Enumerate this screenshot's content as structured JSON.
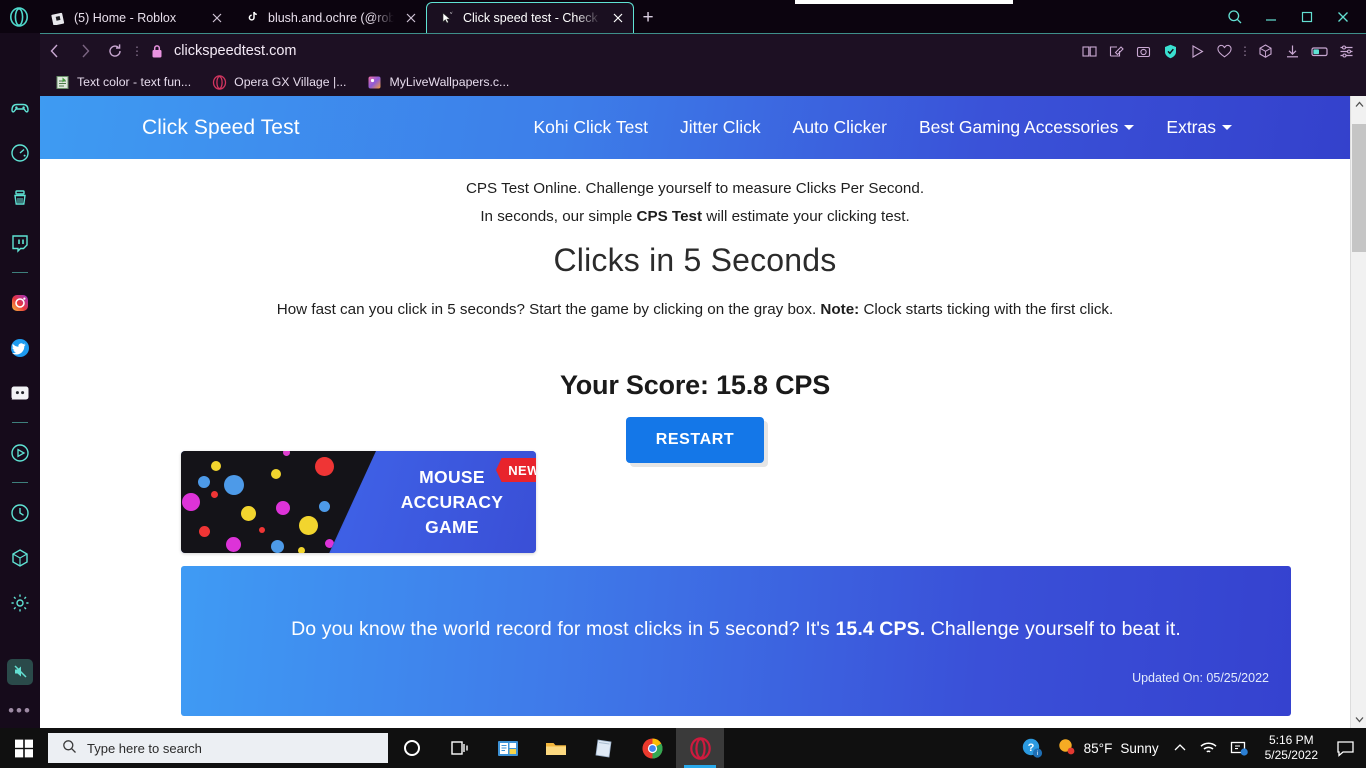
{
  "browser": {
    "name": "Opera GX",
    "tabs": [
      {
        "title": "(5) Home - Roblox",
        "favicon": "roblox-icon",
        "active": false
      },
      {
        "title": "blush.and.ochre (@roblox_b",
        "favicon": "tiktok-icon",
        "active": false
      },
      {
        "title": "Click speed test - Check Cli",
        "favicon": "cursor-icon",
        "active": true
      }
    ],
    "new_tab_label": "+",
    "window_controls": {
      "search": "search-icon",
      "minimize": "minimize-icon",
      "maximize": "maximize-icon",
      "close": "close-icon"
    },
    "toolbar": {
      "back": "back-arrow-icon",
      "forward": "forward-arrow-icon",
      "reload": "reload-icon",
      "lock": "lock-icon",
      "url": "clickspeedtest.com",
      "right_icons": [
        "reader-icon",
        "snapshot-edit-icon",
        "camera-icon",
        "vpn-shield-icon",
        "player-icon",
        "heart-icon",
        "extensions-cube-icon",
        "downloads-icon",
        "tab-island-icon",
        "easy-setup-icon"
      ]
    },
    "bookmarks": [
      {
        "label": "Text color - text fun...",
        "icon": "document-icon"
      },
      {
        "label": "Opera GX Village |...",
        "icon": "opera-gx-icon"
      },
      {
        "label": "MyLiveWallpapers.c...",
        "icon": "wallpaper-icon"
      }
    ],
    "sidebar_items": [
      {
        "name": "gx-corner-gamepad-icon"
      },
      {
        "name": "gx-control-speedometer-icon"
      },
      {
        "name": "gx-cleaner-icon"
      },
      {
        "name": "twitch-icon"
      },
      {
        "name": "instagram-icon"
      },
      {
        "name": "twitter-icon"
      },
      {
        "name": "discord-icon"
      },
      {
        "name": "player-icon"
      },
      {
        "name": "history-clock-icon"
      },
      {
        "name": "extensions-cube-icon"
      },
      {
        "name": "settings-gear-icon"
      },
      {
        "name": "mute-tab-icon"
      },
      {
        "name": "more-dots-icon"
      }
    ],
    "scrollbar": {
      "up": "chevron-up-icon",
      "down": "chevron-down-icon"
    }
  },
  "site": {
    "brand": "Click Speed Test",
    "nav": [
      {
        "label": "Kohi Click Test",
        "dropdown": false
      },
      {
        "label": "Jitter Click",
        "dropdown": false
      },
      {
        "label": "Auto Clicker",
        "dropdown": false
      },
      {
        "label": "Best Gaming Accessories",
        "dropdown": true
      },
      {
        "label": "Extras",
        "dropdown": true
      }
    ],
    "intro_line1": "CPS Test Online. Challenge yourself to measure Clicks Per Second.",
    "intro_line2_a": "In seconds, our simple ",
    "intro_line2_b": "CPS Test",
    "intro_line2_c": " will estimate your clicking test.",
    "heading": "Clicks in 5 Seconds",
    "subtext_a": "How fast can you click in 5 seconds? Start the game by clicking on the gray box. ",
    "subtext_b": "Note:",
    "subtext_c": " Clock starts ticking with the first click.",
    "score_label": "Your Score: 15.8 CPS",
    "restart_label": "RESTART",
    "accuracy_banner": {
      "line1": "MOUSE",
      "line2": "ACCURACY",
      "line3": "GAME",
      "badge": "NEW"
    },
    "world_record": {
      "text_a": "Do you know the world record for most clicks in 5 second? It's ",
      "text_b": "15.4 CPS.",
      "text_c": " Challenge yourself to beat it.",
      "updated": "Updated On: 05/25/2022"
    },
    "colors": {
      "header_start": "#3e9bf2",
      "header_end": "#3441cc",
      "button_blue": "#1477e8",
      "badge_red": "#e8232c"
    }
  },
  "taskbar": {
    "start": "windows-start-icon",
    "search_placeholder": "Type here to search",
    "items": [
      {
        "name": "cortana-icon"
      },
      {
        "name": "task-view-icon"
      },
      {
        "name": "mail-store-icon"
      },
      {
        "name": "file-explorer-icon"
      },
      {
        "name": "sticky-notes-icon"
      },
      {
        "name": "google-chrome-icon"
      },
      {
        "name": "opera-gx-icon",
        "active": true
      }
    ],
    "tray": {
      "help": "help-icon",
      "weather_temp": "85°F",
      "weather_desc": "Sunny",
      "overflow": "chevron-up-icon",
      "wifi": "wifi-icon",
      "network": "network-icon",
      "time": "5:16 PM",
      "date": "5/25/2022",
      "action_center": "action-center-icon"
    }
  }
}
